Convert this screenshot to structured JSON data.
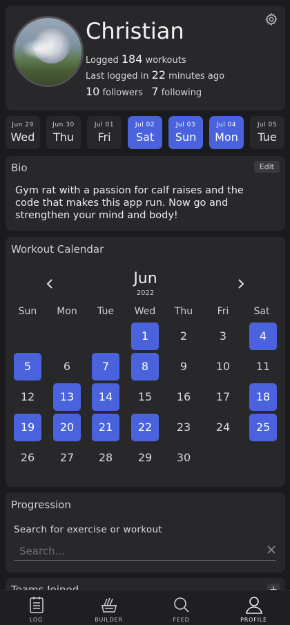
{
  "profile": {
    "name": "Christian",
    "workouts_prefix": "Logged",
    "workouts_count": "184",
    "workouts_suffix": "workouts",
    "last_prefix": "Last logged in",
    "last_value": "22",
    "last_suffix": "minutes ago",
    "followers_count": "10",
    "followers_label": "followers",
    "following_count": "7",
    "following_label": "following"
  },
  "days": [
    {
      "date": "Jun 29",
      "day": "Wed",
      "active": false
    },
    {
      "date": "Jun 30",
      "day": "Thu",
      "active": false
    },
    {
      "date": "Jul 01",
      "day": "Fri",
      "active": false
    },
    {
      "date": "Jul 02",
      "day": "Sat",
      "active": true
    },
    {
      "date": "Jul 03",
      "day": "Sun",
      "active": true
    },
    {
      "date": "Jul 04",
      "day": "Mon",
      "active": true
    },
    {
      "date": "Jul 05",
      "day": "Tue",
      "active": false
    }
  ],
  "bio": {
    "title": "Bio",
    "edit_label": "Edit",
    "text": "Gym rat with a passion for calf raises and the code that makes this app run. Now go and strengthen your mind and body!"
  },
  "calendar": {
    "title": "Workout Calendar",
    "month": "Jun",
    "year": "2022",
    "weekdays": [
      "Sun",
      "Mon",
      "Tue",
      "Wed",
      "Thu",
      "Fri",
      "Sat"
    ],
    "first_weekday_index": 3,
    "days_in_month": 30,
    "highlighted": [
      1,
      4,
      5,
      7,
      8,
      13,
      14,
      18,
      19,
      20,
      21,
      22,
      25
    ]
  },
  "progression": {
    "title": "Progression",
    "search_label": "Search for exercise or workout",
    "search_placeholder": "Search...",
    "search_value": ""
  },
  "teams": {
    "title": "Teams Joined",
    "add_label": "+"
  },
  "nav": {
    "items": [
      {
        "label": "LOG",
        "icon": "log-icon"
      },
      {
        "label": "BUILDER",
        "icon": "builder-icon"
      },
      {
        "label": "FEED",
        "icon": "search-icon"
      },
      {
        "label": "PROFILE",
        "icon": "profile-icon"
      }
    ],
    "current": "PROFILE"
  },
  "colors": {
    "accent": "#4a63dc",
    "background": "#1b1b1d",
    "card": "#28282b"
  }
}
